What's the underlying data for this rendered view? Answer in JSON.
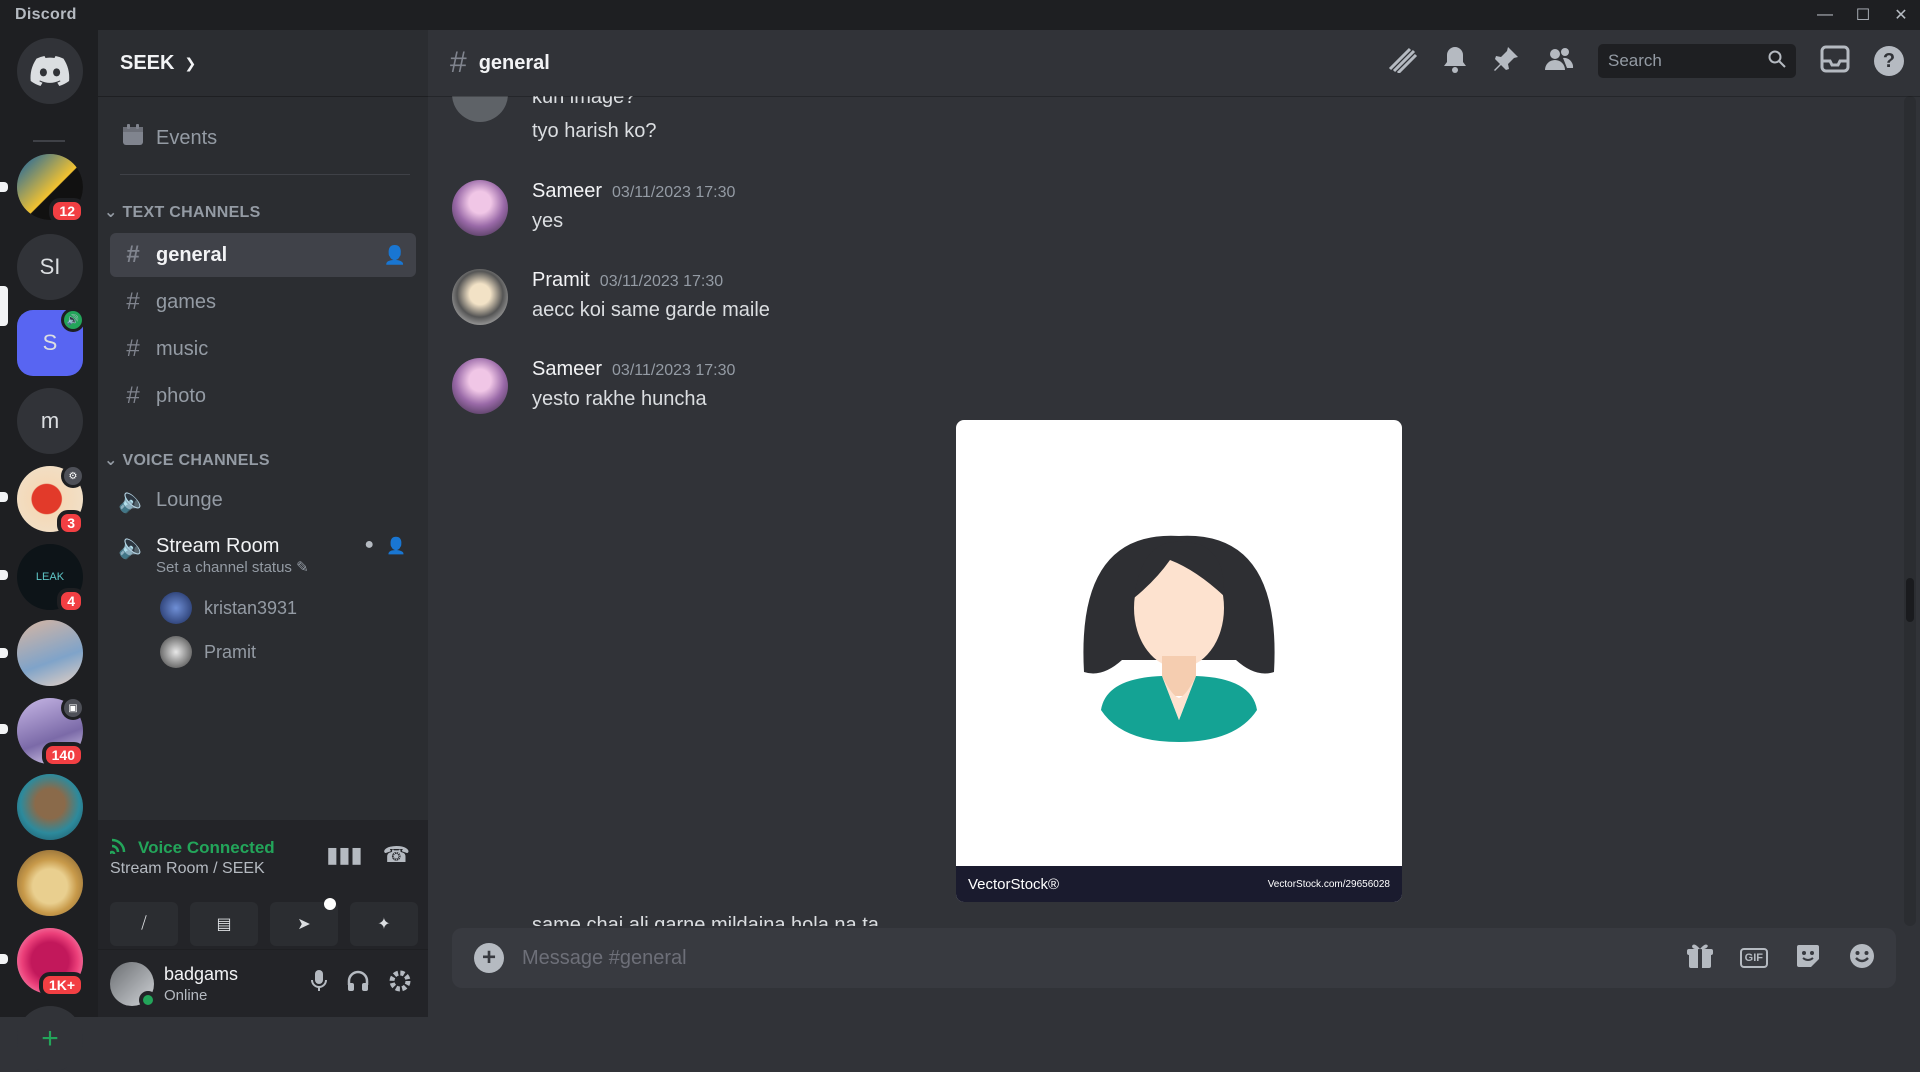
{
  "window": {
    "app_title": "Discord"
  },
  "guilds": {
    "items": [
      {
        "label": "",
        "badge": "12"
      },
      {
        "label": "SI",
        "badge": ""
      },
      {
        "label": "S",
        "badge": ""
      },
      {
        "label": "m",
        "badge": ""
      },
      {
        "label": "",
        "badge": "3"
      },
      {
        "label": "LEAK",
        "badge": "4"
      },
      {
        "label": "",
        "badge": ""
      },
      {
        "label": "",
        "badge": "140"
      },
      {
        "label": "",
        "badge": ""
      },
      {
        "label": "",
        "badge": ""
      },
      {
        "label": "",
        "badge": "1K+"
      }
    ],
    "add_label": "+"
  },
  "sidebar": {
    "server_name": "SEEK",
    "events_label": "Events",
    "text_category": "TEXT CHANNELS",
    "text_channels": [
      "general",
      "games",
      "music",
      "photo"
    ],
    "voice_category": "VOICE CHANNELS",
    "voice_channels": [
      "Lounge",
      "Stream Room"
    ],
    "channel_status_placeholder": "Set a channel status",
    "voice_users": [
      "kristan3931",
      "Pramit"
    ]
  },
  "voice_panel": {
    "status": "Voice Connected",
    "location": "Stream Room / SEEK"
  },
  "user_panel": {
    "username": "badgams",
    "status": "Online"
  },
  "header": {
    "channel_name": "general",
    "search_placeholder": "Search"
  },
  "messages": [
    {
      "text": "kun image?"
    },
    {
      "text": "tyo harish ko?"
    },
    {
      "author": "Sameer",
      "time": "03/11/2023 17:30",
      "text": "yes"
    },
    {
      "author": "Pramit",
      "time": "03/11/2023 17:30",
      "text": "aecc koi same garde maile"
    },
    {
      "author": "Sameer",
      "time": "03/11/2023 17:30",
      "text": "yesto rakhe huncha"
    },
    {
      "text": "same chai ali garne mildaina hola na ta"
    }
  ],
  "attachment": {
    "brand": "VectorStock®",
    "url_text": "VectorStock.com/29656028"
  },
  "composer": {
    "placeholder": "Message #general",
    "gif_label": "GIF"
  },
  "colors": {
    "accent": "#5865f2",
    "online": "#23a55a",
    "danger": "#f23f43"
  }
}
